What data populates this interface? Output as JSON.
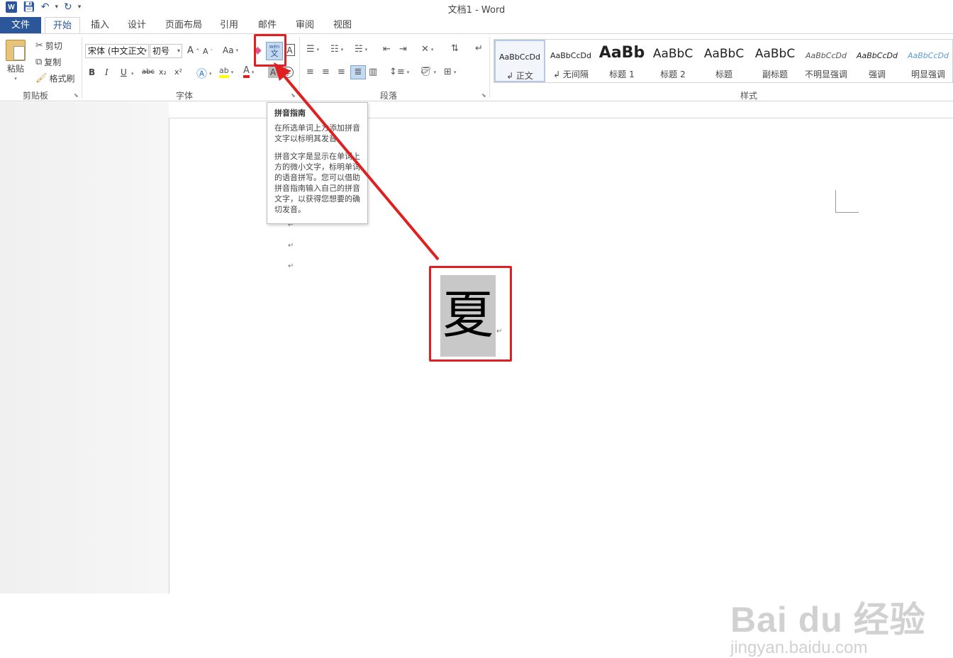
{
  "titlebar": {
    "doc_title": "文档1 - Word",
    "app_icon": "W"
  },
  "tabs": {
    "file": "文件",
    "items": [
      "开始",
      "插入",
      "设计",
      "页面布局",
      "引用",
      "邮件",
      "审阅",
      "视图"
    ],
    "active": "开始"
  },
  "clipboard": {
    "paste": "粘贴",
    "cut": "剪切",
    "copy": "复制",
    "format_painter": "格式刷",
    "group": "剪贴板"
  },
  "font": {
    "font_name": "宋体 (中文正文",
    "font_size": "初号",
    "group": "字体",
    "case_label": "Aa",
    "bold": "B",
    "italic": "I",
    "underline": "U",
    "strike": "abc",
    "subscript": "x₂",
    "superscript": "x²",
    "char_border_glyph": "A",
    "phonetic_guide_glyph": "文",
    "phonetic_guide_pinyin": "wén"
  },
  "paragraph": {
    "group": "段落"
  },
  "styles": {
    "group": "样式",
    "items": [
      {
        "sample": "AaBbCcDd",
        "name": "↲ 正文"
      },
      {
        "sample": "AaBbCcDd",
        "name": "↲ 无间隔"
      },
      {
        "sample": "AaBb",
        "name": "标题 1"
      },
      {
        "sample": "AaBbC",
        "name": "标题 2"
      },
      {
        "sample": "AaBbC",
        "name": "标题"
      },
      {
        "sample": "AaBbC",
        "name": "副标题"
      },
      {
        "sample": "AaBbCcDd",
        "name": "不明显强调"
      },
      {
        "sample": "AaBbCcDd",
        "name": "强调"
      },
      {
        "sample": "AaBbCcDd",
        "name": "明显强调"
      }
    ]
  },
  "tooltip": {
    "title": "拼音指南",
    "p1": "在所选单词上方添加拼音文字以标明其发音。",
    "p2": "拼音文字是显示在单词上方的微小文字，标明单词的语音拼写。您可以借助拼音指南输入自己的拼音文字，以获得您想要的确切发音。"
  },
  "document": {
    "selected_char": "夏",
    "para_mark": "↵"
  },
  "watermark": {
    "logo": "Bai du 经验",
    "url": "jingyan.baidu.com"
  },
  "colors": {
    "accent": "#2b579a",
    "annotation_red": "#e02020",
    "selection_gray": "#c8c8c8"
  }
}
